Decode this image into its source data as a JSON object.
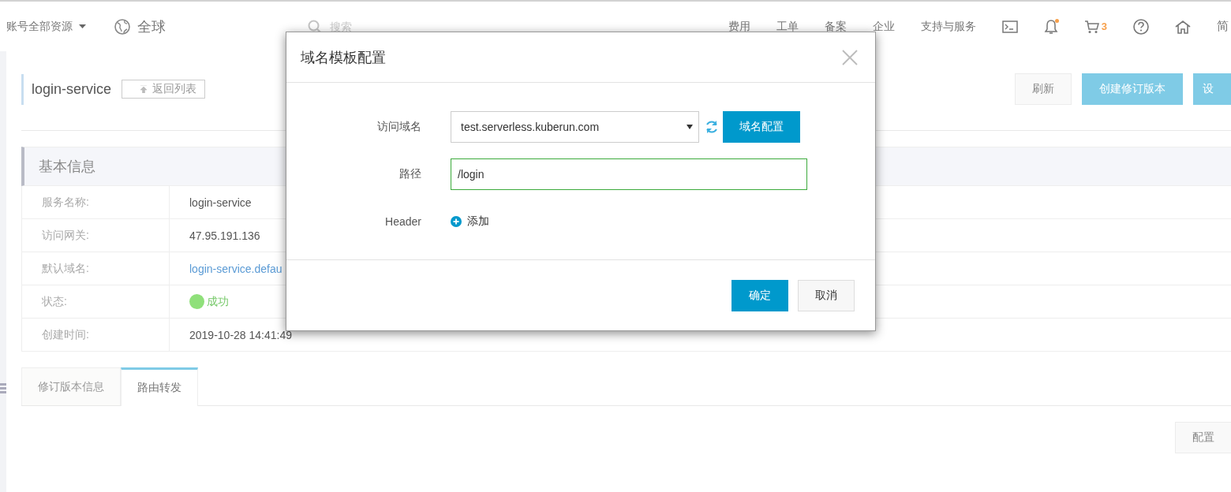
{
  "top_bar": {
    "account_menu": "账号全部资源",
    "region": "全球",
    "search": {
      "placeholder": "搜索"
    },
    "nav": [
      "费用",
      "工单",
      "备案",
      "企业",
      "支持与服务"
    ],
    "notifications": {
      "unread": true
    },
    "cart_count": "3",
    "language": "简"
  },
  "page": {
    "title": "login-service",
    "back_button": "返回列表",
    "actions": [
      {
        "label": "刷新",
        "kind": "default"
      },
      {
        "label": "创建修订版本",
        "kind": "primary"
      },
      {
        "label": "设",
        "kind": "primary"
      }
    ]
  },
  "basic_info": {
    "title": "基本信息",
    "rows": [
      {
        "label": "服务名称:",
        "value": "login-service",
        "kind": "text"
      },
      {
        "label": "访问网关:",
        "value": "47.95.191.136",
        "kind": "text"
      },
      {
        "label": "默认域名:",
        "value": "login-service.defau",
        "kind": "link"
      },
      {
        "label": "状态:",
        "value": "成功",
        "kind": "status"
      },
      {
        "label": "创建时间:",
        "value": "2019-10-28 14:41:49",
        "kind": "text"
      }
    ]
  },
  "tabs": [
    {
      "label": "修订版本信息",
      "selected": false
    },
    {
      "label": "路由转发",
      "selected": true
    }
  ],
  "tab_actions": [
    "配置"
  ],
  "dialog": {
    "title": "域名模板配置",
    "fields": [
      {
        "label": "访问域名",
        "kind": "select",
        "value": "test.serverless.kuberun.com",
        "button": "域名配置"
      },
      {
        "label": "路径",
        "kind": "input",
        "value": "/login",
        "valid": true
      },
      {
        "label": "Header",
        "kind": "add",
        "action": "添加"
      }
    ],
    "buttons": [
      {
        "label": "确定",
        "kind": "primary"
      },
      {
        "label": "取消",
        "kind": "default"
      }
    ]
  }
}
